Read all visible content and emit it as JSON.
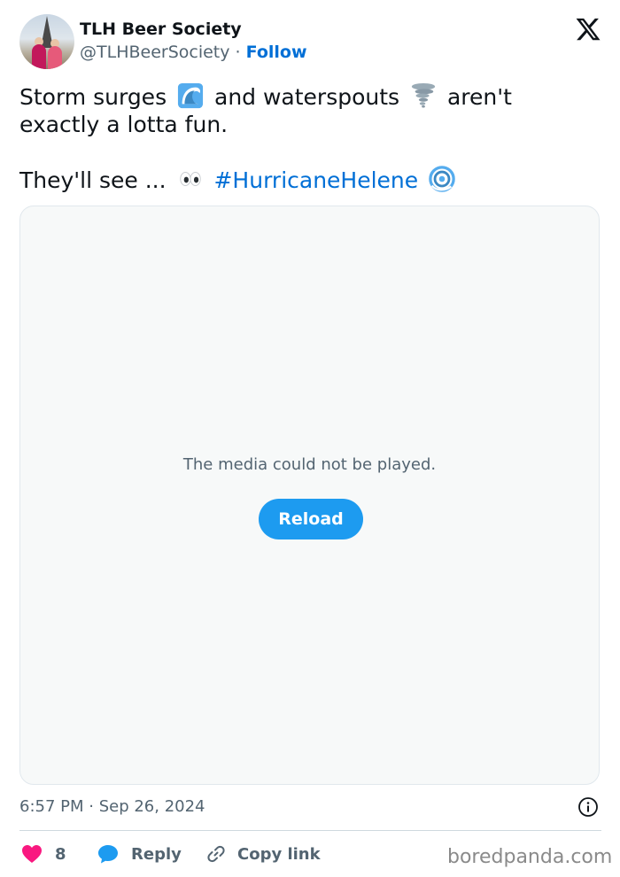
{
  "author": {
    "display_name": "TLH Beer Society",
    "handle": "@TLHBeerSociety",
    "separator": "·",
    "follow_label": "Follow"
  },
  "tweet": {
    "line1_a": "Storm surges",
    "line1_b": "and waterspouts",
    "line1_c": "aren't",
    "line2": "exactly a lotta fun.",
    "line3_a": "They'll see ...",
    "hashtag": "#HurricaneHelene",
    "emojis": [
      "water-wave-icon",
      "tornado-icon",
      "eyes-icon",
      "cyclone-icon"
    ]
  },
  "media": {
    "message": "The media could not be played.",
    "reload_label": "Reload"
  },
  "meta": {
    "timestamp": "6:57 PM · Sep 26, 2024"
  },
  "actions": {
    "like_count": "8",
    "reply_label": "Reply",
    "copy_label": "Copy link"
  },
  "watermark": "boredpanda.com",
  "colors": {
    "link": "#006fd6",
    "button": "#1d9bf0",
    "heart": "#f91880",
    "reply_icon": "#1d9bf0",
    "muted": "#536471"
  }
}
